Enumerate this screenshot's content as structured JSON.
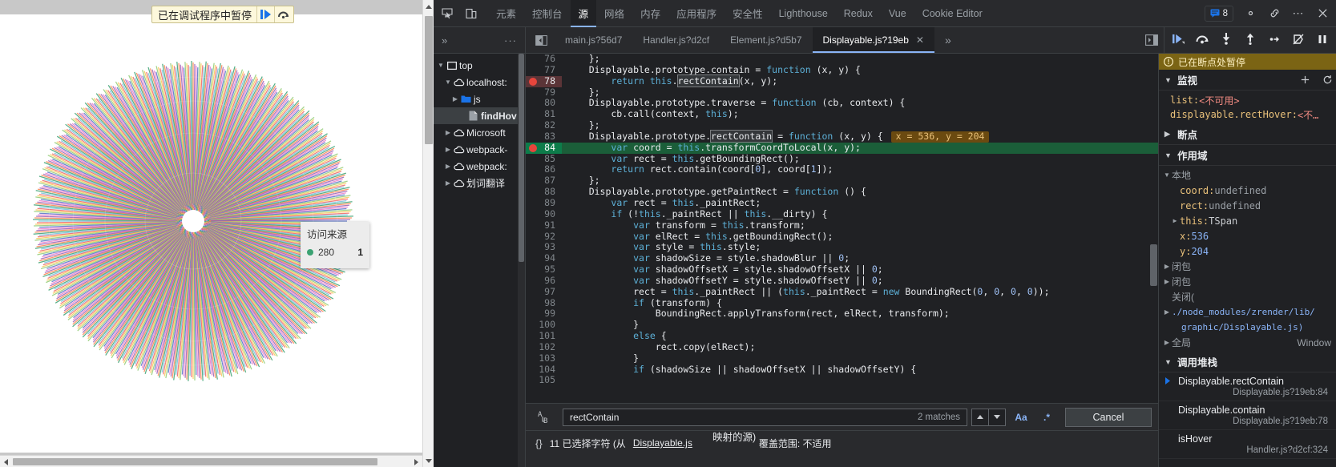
{
  "page": {
    "paused_banner": {
      "label": "已在调试程序中暂停",
      "resume_icon": "resume-icon",
      "stepover_icon": "step-over-icon"
    },
    "tooltip": {
      "title": "访问来源",
      "series_name": "280",
      "value": "1",
      "dot_color": "#3ba272"
    }
  },
  "devtools": {
    "main_tabs": [
      {
        "label": "元素",
        "selected": false
      },
      {
        "label": "控制台",
        "selected": false
      },
      {
        "label": "源",
        "selected": true
      },
      {
        "label": "网络",
        "selected": false
      },
      {
        "label": "内存",
        "selected": false
      },
      {
        "label": "应用程序",
        "selected": false
      },
      {
        "label": "安全性",
        "selected": false
      },
      {
        "label": "Lighthouse",
        "selected": false
      },
      {
        "label": "Redux",
        "selected": false
      },
      {
        "label": "Vue",
        "selected": false
      },
      {
        "label": "Cookie Editor",
        "selected": false
      }
    ],
    "inspect_icon": "inspect-element-icon",
    "device_icon": "device-toolbar-icon",
    "message_badge": {
      "icon": "message-icon",
      "count": "8"
    },
    "settings_icon": "gear-icon",
    "customize_icon": "more-vertical-icon",
    "close_icon": "close-icon",
    "link_icon": "link-icon",
    "source_tabs": [
      {
        "label": "main.js?56d7",
        "selected": false,
        "closable": false
      },
      {
        "label": "Handler.js?d2cf",
        "selected": false,
        "closable": false
      },
      {
        "label": "Element.js?d5b7",
        "selected": false,
        "closable": false
      },
      {
        "label": "Displayable.js?19eb",
        "selected": true,
        "closable": true
      }
    ],
    "source_tabs_more": "»",
    "nav_more": "»",
    "nav_dots": "···",
    "show_navigator_icon": "show-navigator-icon",
    "show_debugger_icon": "show-debugger-icon",
    "navigator": [
      {
        "label": "top",
        "indent": 0,
        "arrow": "▼",
        "icon": "frame-icon"
      },
      {
        "label": "localhost:",
        "indent": 1,
        "arrow": "▼",
        "icon": "cloud-icon"
      },
      {
        "label": "js",
        "indent": 2,
        "arrow": "▶",
        "icon": "folder-icon"
      },
      {
        "label": "findHov",
        "indent": 3,
        "arrow": "",
        "icon": "file-icon",
        "selected": true
      },
      {
        "label": "Microsoft",
        "indent": 1,
        "arrow": "▶",
        "icon": "cloud-icon"
      },
      {
        "label": "webpack-",
        "indent": 1,
        "arrow": "▶",
        "icon": "cloud-icon"
      },
      {
        "label": "webpack:",
        "indent": 1,
        "arrow": "▶",
        "icon": "cloud-icon"
      },
      {
        "label": "划词翻译",
        "indent": 1,
        "arrow": "▶",
        "icon": "cloud-icon"
      }
    ],
    "code_lines": [
      {
        "num": "76",
        "text": "    };"
      },
      {
        "num": "77",
        "text": "    Displayable.prototype.contain = function (x, y) {"
      },
      {
        "num": "78",
        "text": "        return this.rectContain(x, y);",
        "breakpoint": true,
        "boxed": "rectContain"
      },
      {
        "num": "79",
        "text": "    };"
      },
      {
        "num": "80",
        "text": "    Displayable.prototype.traverse = function (cb, context) {"
      },
      {
        "num": "81",
        "text": "        cb.call(context, this);"
      },
      {
        "num": "82",
        "text": "    };"
      },
      {
        "num": "83",
        "text": "    Displayable.prototype.rectContain = function (x, y) {",
        "boxed": "rectContain",
        "inline_value": "x = 536, y = 204"
      },
      {
        "num": "84",
        "text": "        var coord = this.transformCoordToLocal(x, y);",
        "breakpoint": true,
        "current": true
      },
      {
        "num": "85",
        "text": "        var rect = this.getBoundingRect();"
      },
      {
        "num": "86",
        "text": "        return rect.contain(coord[0], coord[1]);"
      },
      {
        "num": "87",
        "text": "    };"
      },
      {
        "num": "88",
        "text": "    Displayable.prototype.getPaintRect = function () {"
      },
      {
        "num": "89",
        "text": "        var rect = this._paintRect;"
      },
      {
        "num": "90",
        "text": "        if (!this._paintRect || this.__dirty) {"
      },
      {
        "num": "91",
        "text": "            var transform = this.transform;"
      },
      {
        "num": "92",
        "text": "            var elRect = this.getBoundingRect();"
      },
      {
        "num": "93",
        "text": "            var style = this.style;"
      },
      {
        "num": "94",
        "text": "            var shadowSize = style.shadowBlur || 0;"
      },
      {
        "num": "95",
        "text": "            var shadowOffsetX = style.shadowOffsetX || 0;"
      },
      {
        "num": "96",
        "text": "            var shadowOffsetY = style.shadowOffsetY || 0;"
      },
      {
        "num": "97",
        "text": "            rect = this._paintRect || (this._paintRect = new BoundingRect(0, 0, 0, 0));"
      },
      {
        "num": "98",
        "text": "            if (transform) {"
      },
      {
        "num": "99",
        "text": "                BoundingRect.applyTransform(rect, elRect, transform);"
      },
      {
        "num": "100",
        "text": "            }"
      },
      {
        "num": "101",
        "text": "            else {"
      },
      {
        "num": "102",
        "text": "                rect.copy(elRect);"
      },
      {
        "num": "103",
        "text": "            }"
      },
      {
        "num": "104",
        "text": "            if (shadowSize || shadowOffsetX || shadowOffsetY) {"
      },
      {
        "num": "105",
        "text": ""
      }
    ],
    "findbar": {
      "icon": "replace-icon",
      "value": "rectContain",
      "matches": "2 matches",
      "prev_icon": "chevron-up-icon",
      "next_icon": "chevron-down-icon",
      "match_case": "Aa",
      "regex": ".*",
      "cancel_label": "Cancel"
    },
    "statusbar": {
      "pretty_print": "{}",
      "selection": "11 已选择字符 (从",
      "file_link": "Displayable.js",
      "mapped_source": "映射的源)",
      "coverage": "覆盖范围: 不适用"
    },
    "debug_toolbar": [
      {
        "icon": "resume-icon",
        "name": "resume-script-execution"
      },
      {
        "icon": "step-over-icon",
        "name": "step-over-next-function-call"
      },
      {
        "icon": "step-into-icon",
        "name": "step-into-next-function-call"
      },
      {
        "icon": "step-out-icon",
        "name": "step-out-of-current-function"
      },
      {
        "icon": "step-icon",
        "name": "step"
      },
      {
        "icon": "deactivate-breakpoints-icon",
        "name": "deactivate-breakpoints"
      },
      {
        "icon": "pause-on-exceptions-icon",
        "name": "pause-on-exceptions"
      }
    ],
    "warn_strip": {
      "icon": "pause-info-icon",
      "label": "已在断点处暂停"
    },
    "watch": {
      "title": "监视",
      "add_icon": "plus-icon",
      "refresh_icon": "refresh-icon",
      "items": [
        {
          "name": "list:",
          "value": "<不可用>",
          "value_kind": "na"
        },
        {
          "name": "displayable.rectHover:",
          "value": "<不…",
          "value_kind": "na"
        }
      ]
    },
    "breakpoints": {
      "title": "断点",
      "caret": "▶"
    },
    "scope": {
      "title": "作用域",
      "groups": [
        {
          "label": "本地",
          "caret": "▼",
          "indent": 0,
          "rows": [
            {
              "tw": "",
              "name": "coord:",
              "value": "undefined",
              "kind": "und"
            },
            {
              "tw": "",
              "name": "rect:",
              "value": "undefined",
              "kind": "und"
            },
            {
              "tw": "▶",
              "name": "this:",
              "value": "TSpan",
              "kind": "obj"
            },
            {
              "tw": "",
              "name": "x:",
              "value": "536",
              "kind": "num"
            },
            {
              "tw": "",
              "name": "y:",
              "value": "204",
              "kind": "num"
            }
          ]
        },
        {
          "label": "闭包",
          "caret": "▶",
          "indent": 0,
          "rows": []
        },
        {
          "label": "闭包",
          "caret": "▶",
          "indent": 0,
          "rows": []
        },
        {
          "label": "关闭(",
          "caret": "",
          "indent": 0,
          "rows": []
        },
        {
          "label": "./node_modules/zrender/lib/",
          "caret": "▶",
          "indent": 0,
          "link": true,
          "rows": []
        },
        {
          "label": "graphic/Displayable.js)",
          "caret": "",
          "indent": 1,
          "link": true,
          "rows": []
        },
        {
          "label": "全局",
          "caret": "▶",
          "indent": 0,
          "right": "Window",
          "rows": []
        }
      ]
    },
    "callstack": {
      "title": "调用堆栈",
      "frames": [
        {
          "fn": "Displayable.rectContain",
          "loc": "Displayable.js?19eb:84",
          "current": true
        },
        {
          "fn": "Displayable.contain",
          "loc": "Displayable.js?19eb:78",
          "current": false
        },
        {
          "fn": "isHover",
          "loc": "Handler.js?d2cf:324",
          "current": false
        }
      ]
    }
  },
  "colors": {
    "accent": "#8ab4f7",
    "breakpoint": "#e8453c",
    "current_line": "#1b5e39",
    "warning": "#7b6414",
    "devtools_bg": "#202124",
    "devtools_panel": "#292a2d"
  }
}
